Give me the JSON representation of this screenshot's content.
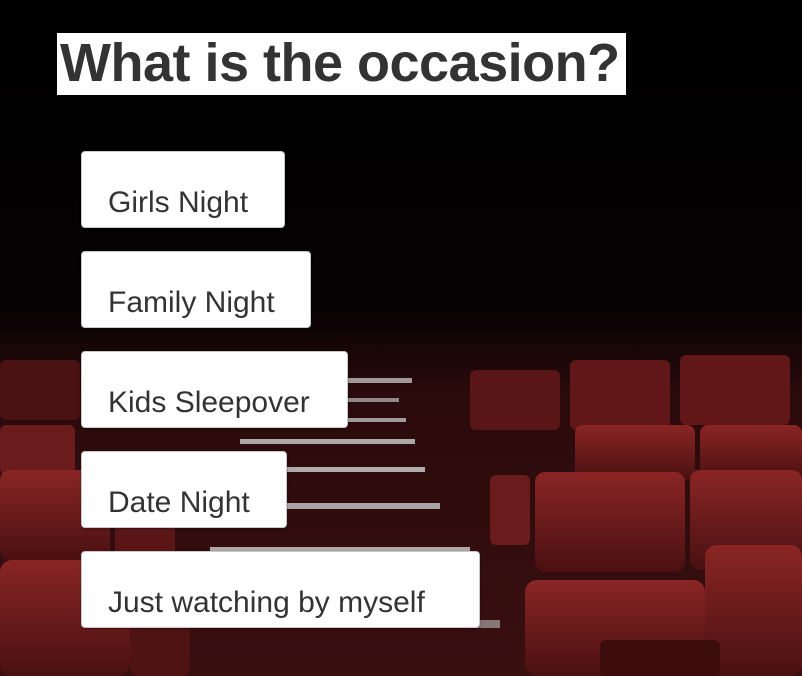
{
  "page": {
    "title": "What is the occasion?"
  },
  "options": [
    {
      "label": "Girls Night"
    },
    {
      "label": "Family Night"
    },
    {
      "label": "Kids Sleepover"
    },
    {
      "label": "Date Night"
    },
    {
      "label": "Just watching by myself"
    }
  ],
  "colors": {
    "seat_red": "#7a1c1c",
    "background": "#000000",
    "button_bg": "#ffffff",
    "text": "#333333"
  }
}
